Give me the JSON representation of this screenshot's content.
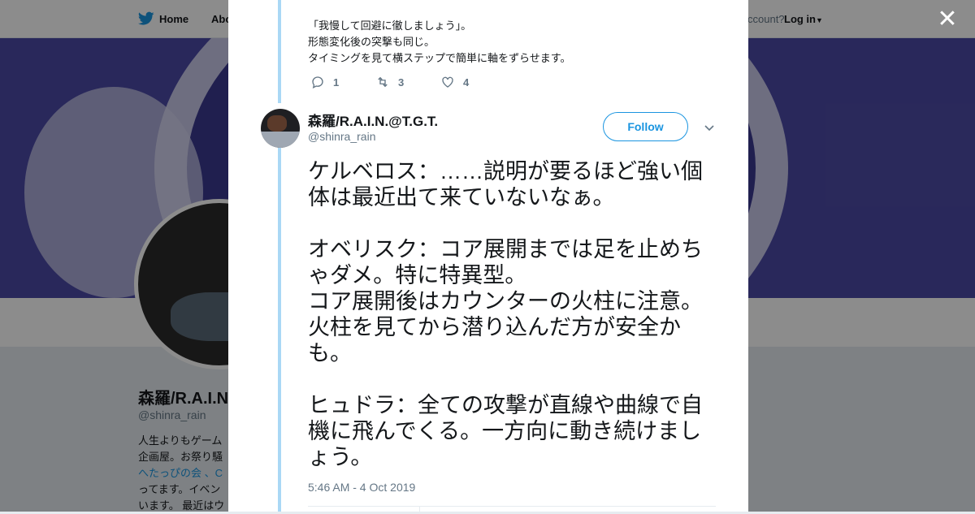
{
  "nav": {
    "home_label": "Home",
    "about_label": "Abo",
    "account_label": "ccount?",
    "login_label": "Log in"
  },
  "profile": {
    "name": "森羅/R.A.I.N",
    "handle": "@shinra_rain",
    "bio_lines": [
      "人生よりもゲーム",
      "企画屋。お祭り騒",
      "へたっぴの会 、C",
      "ってます。イベン",
      "います。 最近はウ"
    ]
  },
  "prev_tweet": {
    "lines": [
      "「我慢して回避に徹しましょう」。",
      "形態変化後の突撃も同じ。",
      "タイミングを見て横ステップで簡単に軸をずらせます。"
    ],
    "reply_count": "1",
    "retweet_count": "3",
    "like_count": "4"
  },
  "tweet": {
    "author_name": "森羅/R.A.I.N.@T.G.T.",
    "author_handle": "@shinra_rain",
    "follow_label": "Follow",
    "text": "ケルベロス：……説明が要るほど強い個体は最近出て来ていないなぁ。\n\nオベリスク：コア展開までは足を止めちゃダメ。特に特異型。\nコア展開後はカウンターの火柱に注意。火柱を見てから潜り込んだ方が安全かも。\n\nヒュドラ：全ての攻撃が直線や曲線で自機に飛んでくる。一方向に動き続けましょう。",
    "timestamp": "5:46 AM - 4 Oct 2019"
  },
  "colors": {
    "twitter_blue": "#1b95e0",
    "thread_line": "#aad8f5",
    "banner": "#4c4aa6"
  },
  "icons": [
    "twitter-bird-icon",
    "close-icon",
    "reply-icon",
    "retweet-icon",
    "like-icon",
    "chevron-down-icon",
    "caret-down-icon"
  ]
}
